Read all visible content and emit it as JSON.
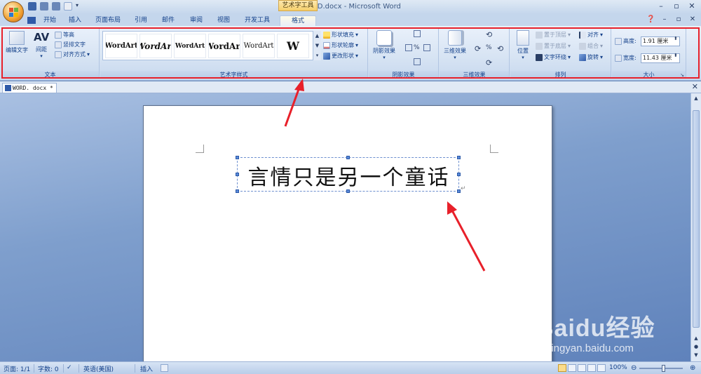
{
  "window": {
    "title": "WORD.docx - Microsoft Word",
    "context_tool": "艺术字工具"
  },
  "tabs": [
    {
      "label": "开始"
    },
    {
      "label": "插入"
    },
    {
      "label": "页面布局"
    },
    {
      "label": "引用"
    },
    {
      "label": "邮件"
    },
    {
      "label": "审阅"
    },
    {
      "label": "视图"
    },
    {
      "label": "开发工具"
    },
    {
      "label": "格式",
      "active": true
    }
  ],
  "ribbon": {
    "text_group": {
      "label": "文本",
      "edit_text": "编辑文字",
      "spacing": "间距",
      "equal_height": "等高",
      "vertical_text": "竖排文字",
      "align_text": "对齐方式"
    },
    "wordart_styles": {
      "label": "艺术字样式",
      "items": [
        "WordArt",
        "WordArt",
        "WordArt",
        "WordArt",
        "WordArt",
        "W"
      ],
      "shape_fill": "形状填充",
      "shape_outline": "形状轮廓",
      "change_shape": "更改形状"
    },
    "shadow_effects": {
      "label": "阴影效果",
      "button": "阴影效果"
    },
    "threed_effects": {
      "label": "三维效果",
      "button": "三维效果"
    },
    "arrange": {
      "label": "排列",
      "position": "位置",
      "bring_front": "置于顶层",
      "send_back": "置于底层",
      "text_wrap": "文字环绕",
      "align": "对齐",
      "group": "组合",
      "rotate": "旋转"
    },
    "size": {
      "label": "大小",
      "height_label": "高度:",
      "height_value": "1.91 厘米",
      "width_label": "宽度:",
      "width_value": "11.43 厘米"
    }
  },
  "document": {
    "tab_label": "WORD. docx *",
    "wordart_text": "言情只是另一个童话",
    "paragraph_mark": "↵"
  },
  "statusbar": {
    "page": "页面: 1/1",
    "words": "字数: 0",
    "language": "英语(美国)",
    "mode": "插入",
    "zoom": "100%"
  },
  "watermark": {
    "brand": "Baidu经验",
    "url": "jingyan.baidu.com"
  },
  "colors": {
    "annotation_red": "#e8202a",
    "ribbon_text": "#15428b"
  }
}
